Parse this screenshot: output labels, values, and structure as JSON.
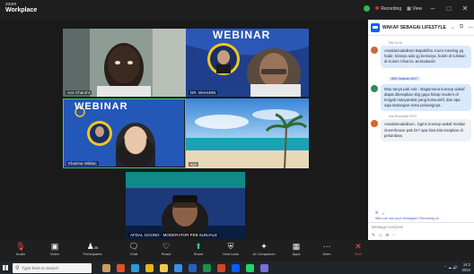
{
  "window": {
    "app_name": "zoom",
    "app_title": "Workplace",
    "recording_label": "Recording",
    "view_label": "View"
  },
  "participants": [
    {
      "name": "Ace Charol's"
    },
    {
      "name": "DR. WAHIDIN"
    },
    {
      "name": "Khairina Wildan"
    },
    {
      "name": "ayu"
    },
    {
      "name": "AFDAL GOUNO - MODERATOR PEB SUNJALE"
    }
  ],
  "banner_text": "WEBINAR",
  "chat": {
    "title": "WAKAF SEBAGAI LIFESTYLE",
    "messages": [
      {
        "sender": "Riki ILHA",
        "text": "Assalamualaikum Bapak/Ibu zoom meeting yg hadir, kiranya ada yg bertanya, boleh di tuliskan di Kolom Chat ini..terimakasih"
      },
      {
        "sender": "BRI Shahab BST",
        "text": "Mau tanya pak Ade : Bagaimana konsep wakaf dapat diterapkan sbg gaya hidup modern di tengah masyarakat yang konsumtif, dan apa saja tantangan serta peluangnya."
      },
      {
        "sender": "Nur Ruumalia RSTI",
        "text": "Assalamualaikum.. bgmn konsep wakaf melalui Greenhouse pak Dr? apa bisa kita terapkan di pekanbaru"
      }
    ],
    "footer_hint": "Who can see your messages? Recording on",
    "input_placeholder": "Message everyone"
  },
  "activate": {
    "title": "Activate Windows",
    "subtitle": "Go to Settings to activate Windows."
  },
  "toolbar": [
    {
      "label": "Audio",
      "icon": "mic-icon"
    },
    {
      "label": "Video",
      "icon": "video-icon"
    },
    {
      "label": "Participants",
      "icon": "participants-icon",
      "count": "26"
    },
    {
      "label": "Chat",
      "icon": "chat-icon"
    },
    {
      "label": "React",
      "icon": "react-icon"
    },
    {
      "label": "Share",
      "icon": "share-icon"
    },
    {
      "label": "Host tools",
      "icon": "shield-icon"
    },
    {
      "label": "AI Companion",
      "icon": "sparkle-icon"
    },
    {
      "label": "Apps",
      "icon": "apps-icon"
    },
    {
      "label": "More",
      "icon": "more-icon"
    },
    {
      "label": "End",
      "icon": "end-icon"
    }
  ],
  "taskbar": {
    "search_placeholder": "Type here to search",
    "time": "14:2",
    "date": "2024"
  },
  "colors": {
    "zoom_blue": "#0b5cff",
    "end_red": "#e02828",
    "active_speaker": "#2bd66a"
  }
}
